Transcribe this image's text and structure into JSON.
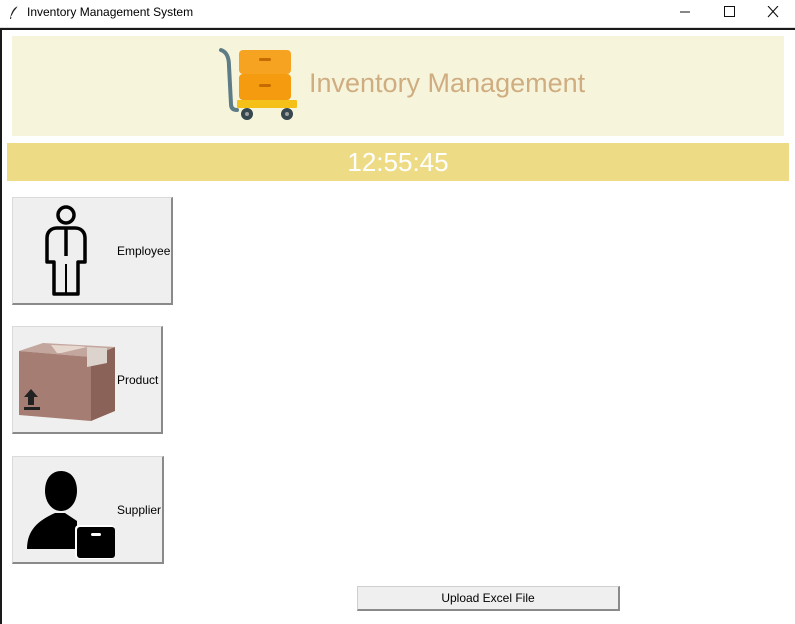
{
  "window": {
    "title": "Inventory Management System",
    "app_icon": "feather-icon",
    "controls": [
      "minimize-icon",
      "maximize-icon",
      "close-icon"
    ]
  },
  "banner": {
    "heading": "Inventory Management",
    "icon": "cart-icon",
    "background_color": "#f6f5dc",
    "heading_color": "#cfad81"
  },
  "clock": {
    "time": "12:55:45",
    "background_color": "#eedb85",
    "text_color": "#ffffff"
  },
  "menu": [
    {
      "label": "Employee",
      "icon": "employee-icon"
    },
    {
      "label": "Product",
      "icon": "box-icon"
    },
    {
      "label": "Supplier",
      "icon": "supplier-icon"
    }
  ],
  "upload": {
    "label": "Upload Excel File"
  }
}
